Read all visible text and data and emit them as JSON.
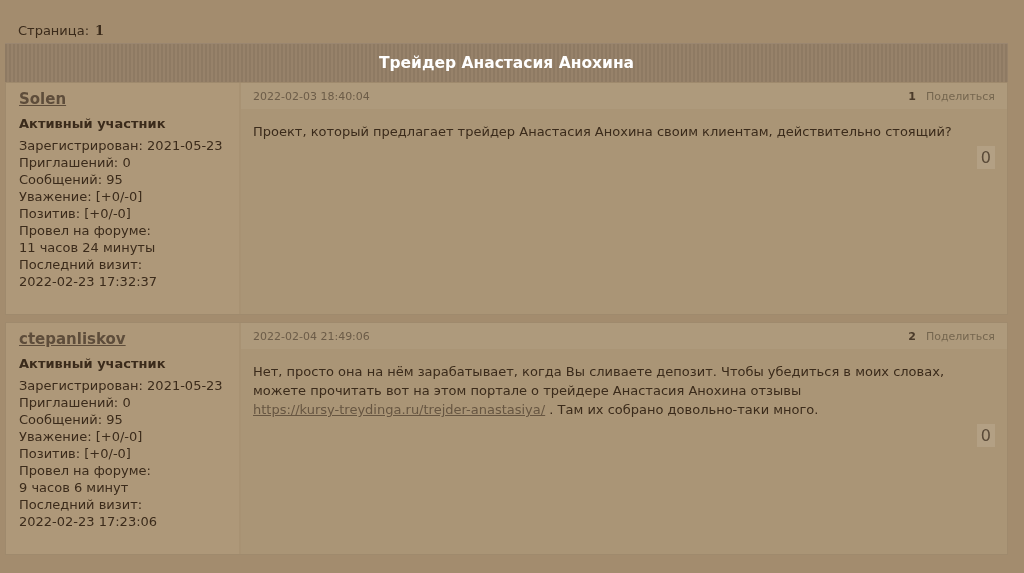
{
  "pagination": {
    "label": "Страница:",
    "current": "1"
  },
  "topic": {
    "title": "Трейдер Анастасия Анохина"
  },
  "posts": [
    {
      "author": "Solen",
      "rank": "Активный участник",
      "stats": [
        "Зарегистрирован: 2021-05-23",
        "Приглашений: 0",
        "Сообщений: 95",
        "Уважение: [+0/-0]",
        "Позитив: [+0/-0]",
        "Провел на форуме:",
        "11 часов 24 минуты",
        "Последний визит:",
        "2022-02-23 17:32:37"
      ],
      "date": "2022-02-03 18:40:04",
      "number": "1",
      "share": "Поделиться",
      "body": [
        {
          "kind": "text",
          "text": "Проект, который предлагает трейдер Анастасия Анохина своим клиентам, действительно стоящий?"
        }
      ],
      "rating": "0"
    },
    {
      "author": "ctepanliskov",
      "rank": "Активный участник",
      "stats": [
        "Зарегистрирован: 2021-05-23",
        "Приглашений: 0",
        "Сообщений: 95",
        "Уважение: [+0/-0]",
        "Позитив: [+0/-0]",
        "Провел на форуме:",
        "9 часов 6 минут",
        "Последний визит:",
        "2022-02-23 17:23:06"
      ],
      "date": "2022-02-04 21:49:06",
      "number": "2",
      "share": "Поделиться",
      "body": [
        {
          "kind": "text",
          "text": "Нет, просто она на нём зарабатывает, когда Вы сливаете депозит. Чтобы убедиться в моих словах, можете прочитать вот на этом портале о трейдере Анастасия Анохина отзывы "
        },
        {
          "kind": "link",
          "text": "https://kursy-treydinga.ru/trejder-anastasiya/"
        },
        {
          "kind": "text",
          "text": " . Там их собрано довольно-таки много."
        }
      ],
      "rating": "0"
    }
  ]
}
